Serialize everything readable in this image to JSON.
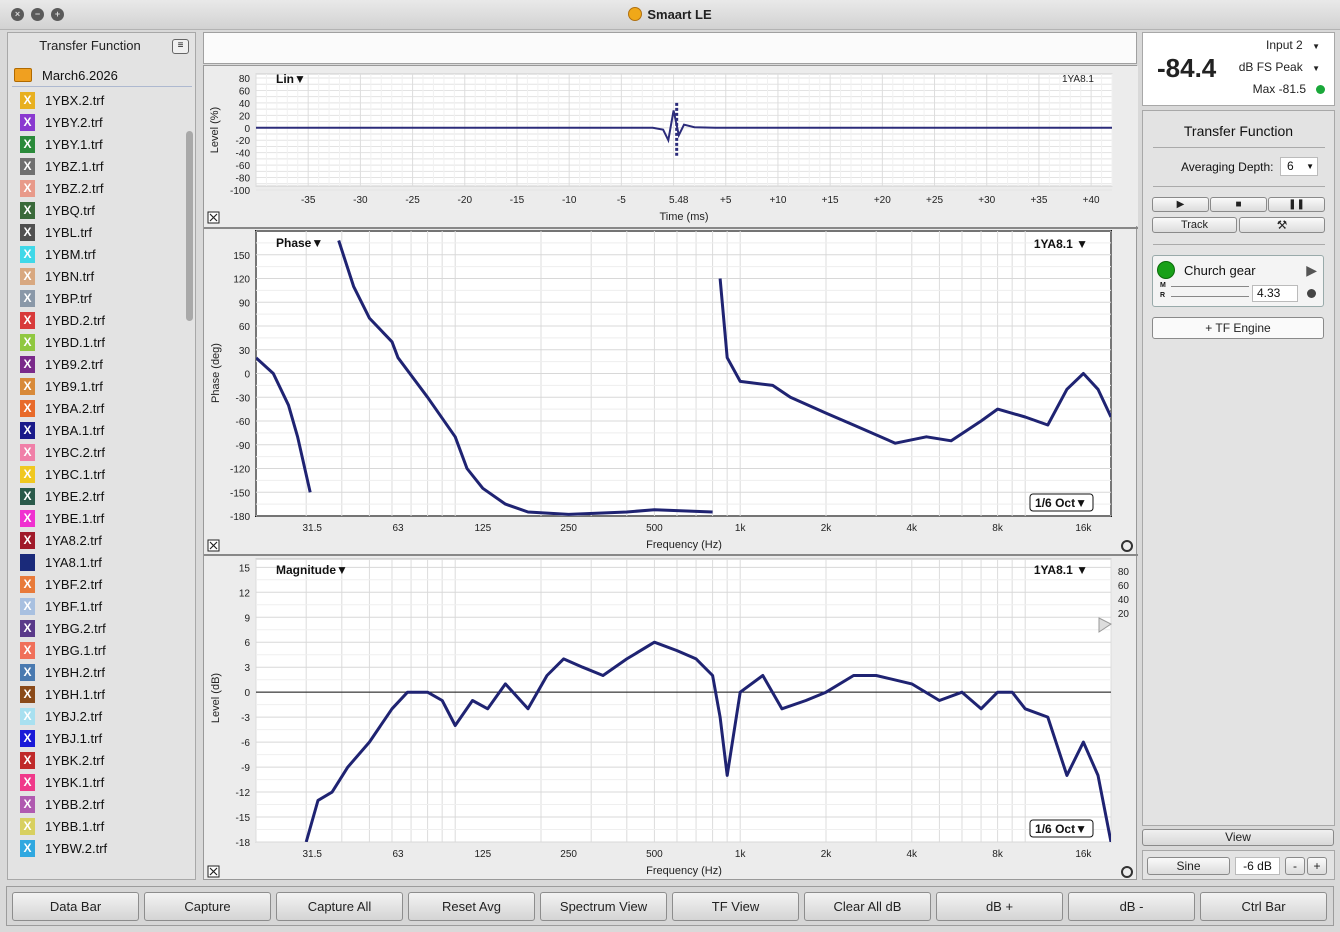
{
  "window": {
    "title": "Smaart LE"
  },
  "left_panel": {
    "title": "Transfer Function",
    "folder": "March6.2026",
    "files": [
      {
        "name": "1YBX.2.trf",
        "color": "#e8b020"
      },
      {
        "name": "1YBY.2.trf",
        "color": "#8a3ad0"
      },
      {
        "name": "1YBY.1.trf",
        "color": "#2a8a3a"
      },
      {
        "name": "1YBZ.1.trf",
        "color": "#707070"
      },
      {
        "name": "1YBZ.2.trf",
        "color": "#e89a8a"
      },
      {
        "name": "1YBQ.trf",
        "color": "#3a6a3a"
      },
      {
        "name": "1YBL.trf",
        "color": "#505050"
      },
      {
        "name": "1YBM.trf",
        "color": "#40d8e8"
      },
      {
        "name": "1YBN.trf",
        "color": "#d8a880"
      },
      {
        "name": "1YBP.trf",
        "color": "#8a98a8"
      },
      {
        "name": "1YBD.2.trf",
        "color": "#d83a3a"
      },
      {
        "name": "1YBD.1.trf",
        "color": "#90c840"
      },
      {
        "name": "1YB9.2.trf",
        "color": "#7a2a8a"
      },
      {
        "name": "1YB9.1.trf",
        "color": "#d88a3a"
      },
      {
        "name": "1YBA.2.trf",
        "color": "#e86a2a"
      },
      {
        "name": "1YBA.1.trf",
        "color": "#1a1a8a"
      },
      {
        "name": "1YBC.2.trf",
        "color": "#f080a8"
      },
      {
        "name": "1YBC.1.trf",
        "color": "#f0c820"
      },
      {
        "name": "1YBE.2.trf",
        "color": "#2a5a4a"
      },
      {
        "name": "1YBE.1.trf",
        "color": "#f030d0"
      },
      {
        "name": "1YA8.2.trf",
        "color": "#a01a2a"
      },
      {
        "name": "1YA8.1.trf",
        "color": "#1a2a7a",
        "plain": true
      },
      {
        "name": "1YBF.2.trf",
        "color": "#e87a3a"
      },
      {
        "name": "1YBF.1.trf",
        "color": "#a8c0e0"
      },
      {
        "name": "1YBG.2.trf",
        "color": "#5a3a8a"
      },
      {
        "name": "1YBG.1.trf",
        "color": "#f0705a"
      },
      {
        "name": "1YBH.2.trf",
        "color": "#4a7ab0"
      },
      {
        "name": "1YBH.1.trf",
        "color": "#8a4a1a"
      },
      {
        "name": "1YBJ.2.trf",
        "color": "#a8e0f0"
      },
      {
        "name": "1YBJ.1.trf",
        "color": "#1a1ad8"
      },
      {
        "name": "1YBK.2.trf",
        "color": "#c02a2a"
      },
      {
        "name": "1YBK.1.trf",
        "color": "#f03a8a"
      },
      {
        "name": "1YBB.2.trf",
        "color": "#b05ab0"
      },
      {
        "name": "1YBB.1.trf",
        "color": "#d8d060"
      },
      {
        "name": "1YBW.2.trf",
        "color": "#30a8e0"
      }
    ],
    "info_icon": "info-icon",
    "trash_icon": "trash-icon"
  },
  "graphs": {
    "impulse": {
      "mode": "Lin▼",
      "trace_label": "1YA8.1",
      "ylabel": "Level (%)",
      "xlabel": "Time (ms)",
      "yticks": [
        "80",
        "60",
        "40",
        "20",
        "0",
        "-20",
        "-40",
        "-60",
        "-80",
        "-100"
      ],
      "xticks": [
        "-35",
        "-30",
        "-25",
        "-20",
        "-15",
        "-10",
        "-5",
        "5.48",
        "+5",
        "+10",
        "+15",
        "+20",
        "+25",
        "+30",
        "+35",
        "+40"
      ]
    },
    "phase": {
      "mode": "Phase▼",
      "trace_label": "1YA8.1 ▼",
      "smoothing": "1/6 Oct▼",
      "ylabel": "Phase (deg)",
      "xlabel": "Frequency (Hz)",
      "yticks": [
        "150",
        "120",
        "90",
        "60",
        "30",
        "0",
        "-30",
        "-60",
        "-90",
        "-120",
        "-150",
        "-180"
      ],
      "xticks": [
        "31.5",
        "63",
        "125",
        "250",
        "500",
        "1k",
        "2k",
        "4k",
        "8k",
        "16k"
      ]
    },
    "magnitude": {
      "mode": "Magnitude▼",
      "trace_label": "1YA8.1 ▼",
      "smoothing": "1/6 Oct▼",
      "ylabel": "Level (dB)",
      "xlabel": "Frequency (Hz)",
      "yticks": [
        "15",
        "12",
        "9",
        "6",
        "3",
        "0",
        "-3",
        "-6",
        "-9",
        "-12",
        "-15",
        "-18"
      ],
      "xticks": [
        "31.5",
        "63",
        "125",
        "250",
        "500",
        "1k",
        "2k",
        "4k",
        "8k",
        "16k"
      ],
      "right_ticks": [
        "80",
        "60",
        "40",
        "20"
      ]
    }
  },
  "meter": {
    "input": "Input 2",
    "value": "-84.4",
    "units": "dB FS Peak",
    "max": "Max -81.5",
    "status_color": "#1aa83a"
  },
  "tf_panel": {
    "title": "Transfer Function",
    "avg_label": "Averaging Depth:",
    "avg_value": "6",
    "track_label": "Track",
    "engine_name": "Church gear",
    "engine_m": "M",
    "engine_r": "R",
    "engine_delay": "4.33",
    "add_engine": "+ TF Engine",
    "status_color": "#18a018"
  },
  "generator": {
    "view_label": "View",
    "signal": "Sine",
    "level": "-6 dB",
    "minus": "-",
    "plus": "+"
  },
  "bottom_bar": [
    "Data Bar",
    "Capture",
    "Capture All",
    "Reset Avg",
    "Spectrum View",
    "TF View",
    "Clear All dB",
    "dB +",
    "dB -",
    "Ctrl Bar"
  ],
  "chart_data": [
    {
      "type": "line",
      "title": "Lin",
      "xlabel": "Time (ms)",
      "ylabel": "Level (%)",
      "ylim": [
        -100,
        80
      ],
      "xlim": [
        -40,
        42
      ],
      "series": [
        {
          "name": "1YA8.1",
          "x": [
            -40,
            -4,
            -2,
            -1,
            -0.5,
            0,
            0.5,
            1,
            2,
            4,
            42
          ],
          "y": [
            0,
            0,
            0,
            -3,
            -20,
            28,
            -12,
            5,
            1,
            0,
            0
          ]
        }
      ]
    },
    {
      "type": "line",
      "title": "Phase",
      "xlabel": "Frequency (Hz)",
      "ylabel": "Phase (deg)",
      "ylim": [
        -180,
        180
      ],
      "x_scale": "log",
      "series": [
        {
          "name": "1YA8.1",
          "x": [
            20,
            23,
            26,
            28,
            31,
            39,
            44,
            50,
            60,
            63,
            80,
            100,
            110,
            125,
            150,
            180,
            250,
            400,
            500,
            800,
            850,
            900,
            1000,
            1300,
            1500,
            2000,
            2500,
            3500,
            4500,
            5500,
            7000,
            8000,
            10000,
            12000,
            14000,
            16000,
            18000,
            20000
          ],
          "y": [
            20,
            0,
            -40,
            -80,
            -150,
            168,
            110,
            70,
            40,
            20,
            -30,
            -80,
            -120,
            -145,
            -165,
            -175,
            -178,
            -175,
            -172,
            -175,
            120,
            20,
            -10,
            -15,
            -30,
            -50,
            -65,
            -88,
            -80,
            -85,
            -60,
            -45,
            -55,
            -65,
            -20,
            0,
            -20,
            -55
          ]
        }
      ]
    },
    {
      "type": "line",
      "title": "Magnitude",
      "xlabel": "Frequency (Hz)",
      "ylabel": "Level (dB)",
      "ylim": [
        -18,
        16
      ],
      "x_scale": "log",
      "series": [
        {
          "name": "1YA8.1",
          "x": [
            30,
            33,
            37,
            42,
            50,
            60,
            68,
            80,
            90,
            100,
            115,
            130,
            150,
            180,
            210,
            240,
            280,
            330,
            400,
            500,
            600,
            700,
            800,
            850,
            900,
            1000,
            1200,
            1400,
            1700,
            2000,
            2500,
            3000,
            4000,
            5000,
            6000,
            7000,
            8000,
            9000,
            10000,
            12000,
            14000,
            16000,
            18000,
            20000
          ],
          "y": [
            -18,
            -13,
            -12,
            -9,
            -6,
            -2,
            0,
            0,
            -1,
            -4,
            -1,
            -2,
            1,
            -2,
            2,
            4,
            3,
            2,
            4,
            6,
            5,
            4,
            2,
            -3,
            -10,
            0,
            2,
            -2,
            -1,
            0,
            2,
            2,
            1,
            -1,
            0,
            -2,
            0,
            0,
            -2,
            -3,
            -10,
            -6,
            -10,
            -18
          ]
        }
      ]
    }
  ]
}
